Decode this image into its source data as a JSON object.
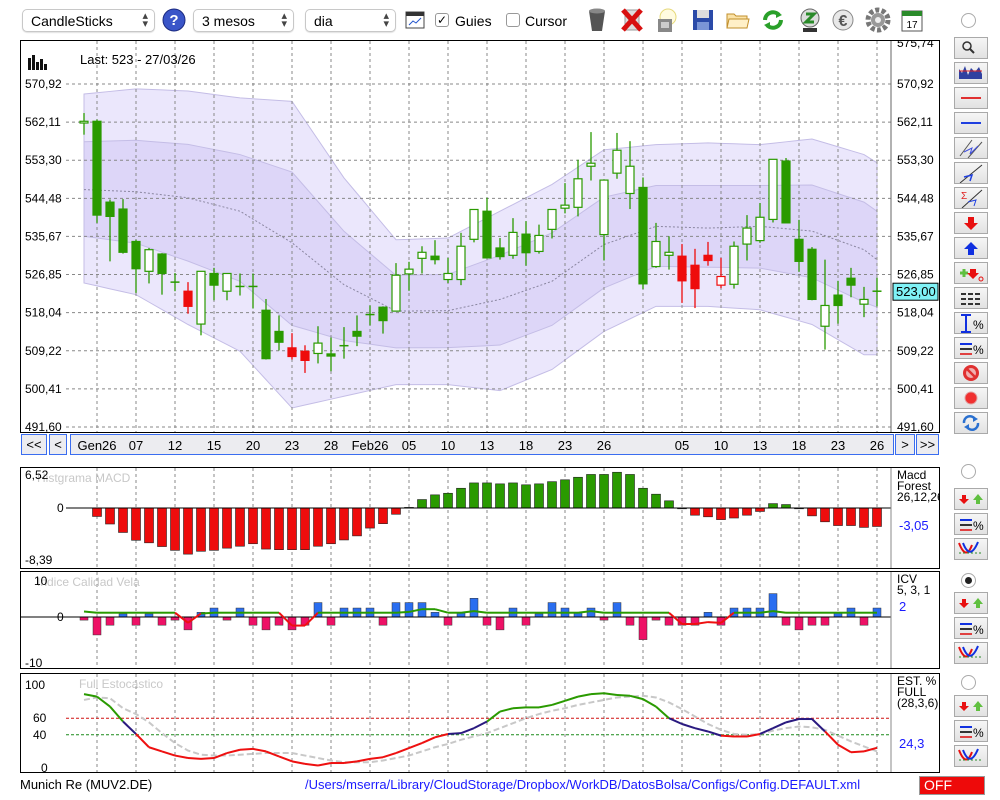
{
  "toolbar": {
    "chart_type": "CandleSticks",
    "period": "3 mesos",
    "interval": "dia",
    "guides_label": "Guies",
    "guides_checked": true,
    "cursor_label": "Cursor",
    "cursor_checked": false,
    "icons": [
      "help-icon",
      "chart-window-icon",
      "trash-icon",
      "delete-icon",
      "lamp-icon",
      "save-icon",
      "folder-icon",
      "refresh-icon",
      "recycle-icon",
      "euro-icon",
      "gear-icon",
      "calendar-icon"
    ],
    "calendar_day": "17"
  },
  "main_chart": {
    "last_label": "Last: 523 - 27/03/26",
    "last_price": "523,00",
    "top_price_label": "575,74",
    "price_labels": [
      "570,92",
      "562,11",
      "553,30",
      "544,48",
      "535,67",
      "526,85",
      "518,04",
      "509,22",
      "500,41",
      "491,60"
    ],
    "colors": {
      "up": "#2a9a00",
      "red": "#ee0c0c",
      "band_outer": "#ebe7fc",
      "band_inner": "#ddd6f8",
      "band_stroke": "#c4bde6",
      "last_box": "#7ff2f6"
    }
  },
  "nav": {
    "first": "<<",
    "prev": "<",
    "next": ">",
    "last": ">>",
    "date_labels": [
      "Gen26",
      "07",
      "12",
      "15",
      "20",
      "23",
      "28",
      "Feb26",
      "05",
      "10",
      "13",
      "18",
      "23",
      "26",
      "",
      "05",
      "10",
      "13",
      "18",
      "23",
      "26"
    ]
  },
  "chart_data": [
    {
      "type": "candlestick",
      "title": "Last: 523 - 27/03/26",
      "ylim": [
        491.6,
        575.74
      ],
      "candles_ohlc": [
        [
          561.9,
          564.2,
          559.2,
          562.3,
          "g"
        ],
        [
          562.3,
          562.7,
          538.8,
          540.6,
          "g"
        ],
        [
          543.6,
          544.2,
          529.9,
          540.3,
          "g"
        ],
        [
          542.0,
          544.3,
          531.7,
          532.0,
          "g"
        ],
        [
          534.5,
          534.9,
          522.6,
          528.2,
          "g"
        ],
        [
          527.6,
          533.0,
          524.8,
          532.6,
          "g"
        ],
        [
          531.6,
          531.8,
          522.2,
          527.1,
          "g"
        ],
        [
          525.1,
          527.2,
          523.0,
          525.1,
          "g"
        ],
        [
          523.0,
          525.1,
          517.8,
          519.5,
          "r"
        ],
        [
          515.4,
          527.6,
          512.8,
          527.6,
          "g"
        ],
        [
          527.1,
          528.4,
          520.9,
          524.4,
          "g"
        ],
        [
          523.0,
          527.1,
          520.9,
          527.1,
          "g"
        ],
        [
          524.1,
          527.1,
          522.0,
          524.1,
          "g"
        ],
        [
          524.1,
          527.1,
          519.0,
          524.1,
          "g"
        ],
        [
          518.6,
          521.2,
          507.2,
          507.4,
          "g"
        ],
        [
          513.7,
          517.4,
          509.3,
          511.2,
          "g"
        ],
        [
          509.9,
          513.3,
          507.2,
          507.9,
          "r"
        ],
        [
          509.1,
          510.5,
          504.1,
          507.0,
          "r"
        ],
        [
          508.6,
          514.9,
          506.3,
          511.0,
          "g"
        ],
        [
          508.5,
          512.3,
          504.5,
          508.0,
          "g"
        ],
        [
          510.4,
          514.7,
          507.4,
          510.4,
          "g"
        ],
        [
          513.7,
          517.4,
          510.3,
          512.6,
          "g"
        ],
        [
          517.6,
          519.7,
          515.1,
          517.6,
          "g"
        ],
        [
          519.3,
          519.5,
          513.2,
          516.2,
          "g"
        ],
        [
          518.4,
          529.5,
          518.4,
          526.7,
          "g"
        ],
        [
          527.0,
          529.8,
          523.1,
          528.1,
          "g"
        ],
        [
          530.6,
          533.4,
          527.1,
          532.0,
          "g"
        ],
        [
          531.1,
          534.8,
          529.2,
          530.3,
          "g"
        ],
        [
          525.7,
          530.7,
          524.9,
          527.1,
          "g"
        ],
        [
          525.7,
          536.5,
          524.4,
          533.4,
          "g"
        ],
        [
          535.0,
          541.9,
          534.3,
          541.9,
          "g"
        ],
        [
          541.5,
          544.6,
          530.7,
          530.7,
          "g"
        ],
        [
          533.0,
          535.3,
          530.3,
          531.0,
          "g"
        ],
        [
          531.3,
          539.9,
          530.5,
          536.6,
          "g"
        ],
        [
          536.2,
          539.2,
          528.9,
          531.9,
          "g"
        ],
        [
          532.2,
          538.4,
          531.7,
          535.9,
          "g"
        ],
        [
          537.3,
          541.9,
          535.2,
          541.9,
          "g"
        ],
        [
          542.2,
          548.0,
          541.0,
          542.9,
          "g"
        ],
        [
          542.4,
          553.4,
          540.3,
          549.0,
          "g"
        ],
        [
          551.9,
          559.8,
          548.6,
          552.6,
          "g"
        ],
        [
          536.1,
          548.7,
          530.1,
          548.7,
          "g"
        ],
        [
          550.3,
          559.6,
          549.0,
          555.6,
          "g"
        ],
        [
          545.6,
          557.7,
          542.0,
          551.9,
          "g"
        ],
        [
          547.0,
          549.3,
          523.5,
          524.7,
          "g"
        ],
        [
          528.7,
          538.8,
          528.4,
          534.5,
          "g"
        ],
        [
          531.3,
          535.7,
          528.0,
          532.0,
          "g"
        ],
        [
          531.1,
          533.9,
          520.3,
          525.4,
          "r"
        ],
        [
          529.0,
          532.8,
          519.1,
          523.6,
          "r"
        ],
        [
          531.3,
          534.4,
          528.9,
          530.1,
          "r"
        ],
        [
          524.4,
          530.7,
          523.7,
          526.4,
          "r"
        ],
        [
          524.6,
          534.5,
          523.6,
          533.4,
          "g"
        ],
        [
          533.9,
          540.6,
          530.1,
          537.6,
          "g"
        ],
        [
          534.7,
          543.4,
          534.2,
          540.1,
          "g"
        ],
        [
          539.6,
          553.5,
          538.9,
          553.5,
          "g"
        ],
        [
          553.1,
          553.8,
          538.8,
          538.8,
          "g"
        ],
        [
          535.0,
          539.5,
          527.5,
          529.9,
          "g"
        ],
        [
          532.7,
          533.2,
          520.9,
          521.1,
          "g"
        ],
        [
          514.9,
          530.3,
          509.5,
          519.7,
          "g"
        ],
        [
          522.1,
          525.4,
          515.5,
          519.7,
          "g"
        ],
        [
          526.0,
          528.4,
          521.6,
          524.4,
          "g"
        ],
        [
          520.0,
          524.0,
          517.0,
          521.1,
          "g"
        ],
        [
          523.0,
          526.1,
          519.5,
          523.0,
          "g"
        ]
      ],
      "bollinger": {
        "sample_index": [
          0,
          4,
          8,
          12,
          16,
          20,
          24,
          28,
          32,
          36,
          40,
          44,
          48,
          52,
          56,
          60,
          61
        ],
        "upper": [
          568.6,
          569.8,
          569.3,
          567.7,
          566.9,
          549.2,
          534.9,
          535.3,
          541.5,
          547.7,
          555.7,
          556.9,
          557.3,
          556.9,
          558.2,
          554.6,
          552.7
        ],
        "middle": [
          546.5,
          546.0,
          544.6,
          541.5,
          534.2,
          524.5,
          518.4,
          518.5,
          521.1,
          525.3,
          533.8,
          538.0,
          537.6,
          538.0,
          536.9,
          532.6,
          530.3
        ],
        "lower": [
          524.9,
          522.2,
          515.3,
          509.1,
          496.0,
          498.7,
          501.4,
          501.4,
          500.0,
          504.9,
          513.7,
          519.5,
          519.5,
          518.7,
          515.3,
          508.3,
          508.3
        ]
      }
    },
    {
      "type": "bar",
      "title": "Histgrama MACD",
      "ylim": [
        -8.39,
        6.52
      ],
      "tick_labels": [
        "6,52",
        "0",
        "-8,39"
      ],
      "values": [
        null,
        -1.54,
        -2.91,
        -4.45,
        -5.87,
        -6.33,
        -7.01,
        -7.7,
        -8.39,
        -7.87,
        -7.7,
        -7.3,
        -6.95,
        -6.5,
        -7.47,
        -7.58,
        -7.58,
        -7.58,
        -6.95,
        -6.5,
        -5.81,
        -5.07,
        -3.65,
        -2.85,
        -1.14,
        0.11,
        1.54,
        2.39,
        2.68,
        3.59,
        4.56,
        4.56,
        4.39,
        4.56,
        4.22,
        4.39,
        4.79,
        5.13,
        5.59,
        6.1,
        6.1,
        6.5,
        6.1,
        3.59,
        2.51,
        1.31,
        0,
        -1.31,
        -1.6,
        -2.11,
        -1.82,
        -1.31,
        -0.63,
        0.8,
        0.63,
        0,
        -1.43,
        -2.51,
        -3.19,
        -3.19,
        -3.53,
        -3.36
      ],
      "side": {
        "line1": "Macd",
        "line2": "Forest",
        "line3": "26,12,26",
        "value": "-3,05"
      }
    },
    {
      "type": "bar",
      "title": "Indice Calidad Vela",
      "ylim": [
        -10,
        10
      ],
      "tick_labels": [
        "10",
        "0",
        "-10"
      ],
      "values": [
        -0.8,
        -4.6,
        -2.1,
        0.8,
        -2.1,
        0.8,
        -2.1,
        -0.8,
        -3.3,
        1.2,
        2.3,
        -0.8,
        2.3,
        -2.1,
        -3.3,
        -2.1,
        -3.3,
        -2.1,
        3.7,
        -2.1,
        2.3,
        2.3,
        2.3,
        -2.1,
        3.7,
        3.7,
        3.7,
        1.2,
        -2.1,
        1.2,
        4.8,
        -2.1,
        -3.3,
        2.3,
        -2.1,
        0.8,
        3.7,
        2.3,
        1.2,
        2.3,
        -0.8,
        3.7,
        -2.1,
        -5.8,
        -0.8,
        -2.1,
        -2.1,
        -2.1,
        1.2,
        -2.1,
        2.3,
        2.3,
        2.3,
        6.0,
        -2.1,
        -3.3,
        -2.1,
        -2.1,
        1.2,
        2.3,
        -2.1,
        2.3
      ],
      "signal": [
        1.4,
        1.1,
        1.1,
        1.1,
        1.1,
        1.1,
        1.1,
        1.1,
        -1.5,
        0.9,
        1.1,
        1.1,
        1.1,
        1.1,
        1.1,
        1.1,
        -2.2,
        -2.2,
        1.1,
        1.1,
        1.1,
        1.1,
        1.1,
        1.1,
        1.1,
        1.3,
        2.0,
        2.0,
        1.1,
        1.1,
        1.5,
        1.1,
        1.1,
        1.1,
        1.1,
        1.1,
        1.1,
        1.1,
        1.1,
        1.5,
        1.1,
        1.1,
        1.1,
        1.1,
        1.1,
        1.1,
        -1.8,
        -1.8,
        -1.3,
        -1.5,
        1.1,
        1.1,
        1.1,
        1.5,
        1.1,
        1.1,
        1.1,
        1.1,
        1.1,
        1.1,
        1.1,
        1.1
      ],
      "side": {
        "line1": "ICV",
        "line2": "5, 3, 1",
        "value": "2"
      }
    },
    {
      "type": "line",
      "title": "Full Estocastico",
      "ylim": [
        0,
        100
      ],
      "tick_labels": [
        "100",
        "60",
        "40",
        "0"
      ],
      "levels": [
        60,
        40
      ],
      "k": [
        89,
        86,
        74,
        56,
        41,
        25,
        20,
        15,
        12,
        11,
        12,
        18,
        22,
        23,
        20,
        14,
        8,
        5,
        3,
        6,
        6,
        8,
        11,
        13,
        18,
        24,
        30,
        37,
        41,
        42,
        48,
        56,
        68,
        72,
        73,
        73,
        76,
        81,
        86,
        89,
        90,
        88,
        87,
        83,
        74,
        60,
        53,
        48,
        44,
        39,
        38,
        38,
        41,
        48,
        55,
        59,
        59,
        44,
        28,
        19,
        20,
        24.3
      ],
      "d": [
        82,
        85,
        84,
        72,
        65,
        55,
        42,
        30,
        21,
        16,
        15,
        15,
        16,
        17,
        18,
        18,
        18,
        15,
        12,
        9,
        7,
        7,
        7,
        9,
        12,
        15,
        20,
        25,
        29,
        34,
        38,
        42,
        48,
        54,
        60,
        65,
        69,
        72,
        76,
        79,
        82,
        85,
        86,
        87,
        85,
        79,
        71,
        62,
        53,
        46,
        41,
        40,
        41,
        45,
        48,
        50,
        49,
        46,
        39,
        32,
        26,
        20
      ],
      "side": {
        "line1": "EST. %",
        "line2": "FULL",
        "line3": "(28,3,6)",
        "value": "24,3"
      }
    }
  ],
  "right_toolbar": [
    "zoom-icon",
    "mini-chart-icon",
    "red-line-icon",
    "blue-line-icon",
    "channel-icon",
    "trend-line-icon",
    "sigma-trend-icon",
    "arrow-down-icon",
    "arrow-up-icon",
    "add-signal-icon",
    "dashes-icon",
    "height-percent-icon",
    "lines-percent-icon",
    "stop-icon",
    "record-icon",
    "refresh-icon"
  ],
  "status": {
    "instrument": "Munich Re (MUV2.DE)",
    "config_path": "/Users/mserra/Library/CloudStorage/Dropbox/WorkDB/DatosBolsa/Configs/Config.DEFAULT.xml",
    "mode": "OFF"
  }
}
